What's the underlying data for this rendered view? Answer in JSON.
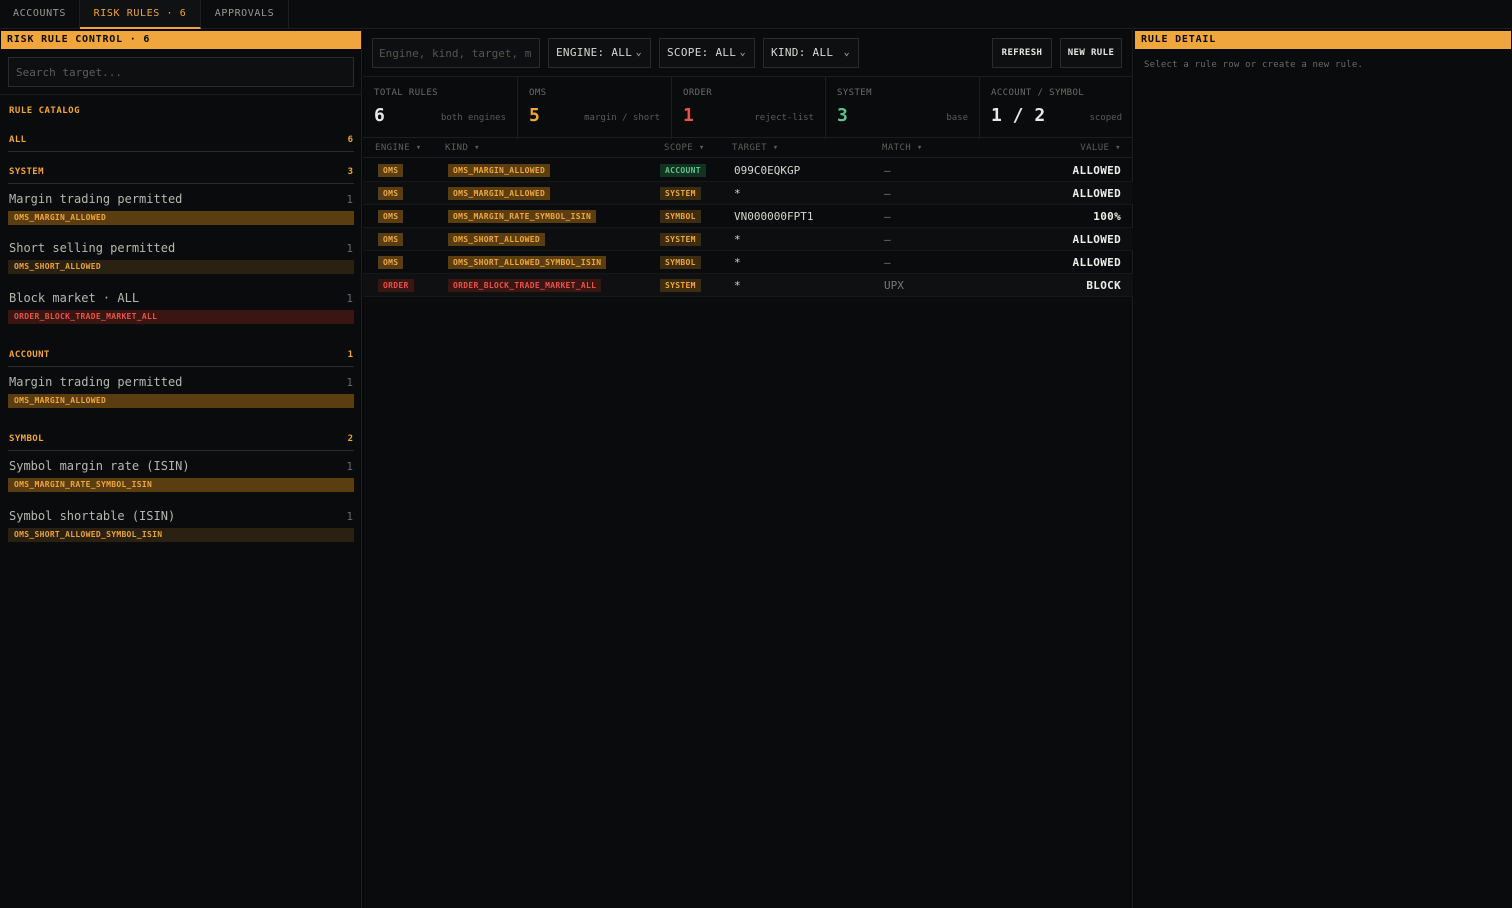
{
  "top_tabs": [
    {
      "label": "ACCOUNTS"
    },
    {
      "label": "RISK RULES · 6"
    },
    {
      "label": "APPROVALS"
    }
  ],
  "left": {
    "header": "RISK RULE CONTROL · 6",
    "search_placeholder": "Search target...",
    "catalog_title": "RULE CATALOG",
    "all": {
      "label": "ALL",
      "count": "6"
    },
    "groups": [
      {
        "label": "SYSTEM",
        "count": "3",
        "items": [
          {
            "name": "Margin trading permitted",
            "count": "1",
            "code": "OMS_MARGIN_ALLOWED",
            "tone": "amber"
          },
          {
            "name": "Short selling permitted",
            "count": "1",
            "code": "OMS_SHORT_ALLOWED",
            "tone": "brown"
          },
          {
            "name": "Block market · ALL",
            "count": "1",
            "code": "ORDER_BLOCK_TRADE_MARKET_ALL",
            "tone": "red"
          }
        ]
      },
      {
        "label": "ACCOUNT",
        "count": "1",
        "items": [
          {
            "name": "Margin trading permitted",
            "count": "1",
            "code": "OMS_MARGIN_ALLOWED",
            "tone": "amber"
          }
        ]
      },
      {
        "label": "SYMBOL",
        "count": "2",
        "items": [
          {
            "name": "Symbol margin rate (ISIN)",
            "count": "1",
            "code": "OMS_MARGIN_RATE_SYMBOL_ISIN",
            "tone": "amber"
          },
          {
            "name": "Symbol shortable (ISIN)",
            "count": "1",
            "code": "OMS_SHORT_ALLOWED_SYMBOL_ISIN",
            "tone": "brown"
          }
        ]
      }
    ]
  },
  "toolbar": {
    "filter_placeholder": "Engine, kind, target, m",
    "engine": "ENGINE: ALL",
    "scope": "SCOPE: ALL",
    "kind": "KIND: ALL",
    "refresh": "REFRESH",
    "new_rule": "NEW RULE"
  },
  "stats": [
    {
      "title": "TOTAL RULES",
      "value": "6",
      "sub": "both engines",
      "color": "#e8e8e4"
    },
    {
      "title": "OMS",
      "value": "5",
      "sub": "margin / short",
      "color": "#f0a63c"
    },
    {
      "title": "ORDER",
      "value": "1",
      "sub": "reject-list",
      "color": "#e5544a"
    },
    {
      "title": "SYSTEM",
      "value": "3",
      "sub": "base",
      "color": "#5fc28a"
    },
    {
      "title": "ACCOUNT / SYMBOL",
      "value": "1 / 2",
      "sub": "scoped",
      "color": "#e8e8e4"
    }
  ],
  "table": {
    "headers": {
      "engine": "ENGINE",
      "kind": "KIND",
      "scope": "SCOPE",
      "target": "TARGET",
      "match": "MATCH",
      "value": "VALUE"
    },
    "sort_glyph": "▾",
    "rows": [
      {
        "engine": "OMS",
        "kind": "OMS_MARGIN_ALLOWED",
        "scope": "ACCOUNT",
        "target": "099C0EQKGP",
        "match": "—",
        "value": "ALLOWED"
      },
      {
        "engine": "OMS",
        "kind": "OMS_MARGIN_ALLOWED",
        "scope": "SYSTEM",
        "target": "*",
        "match": "—",
        "value": "ALLOWED"
      },
      {
        "engine": "OMS",
        "kind": "OMS_MARGIN_RATE_SYMBOL_ISIN",
        "scope": "SYMBOL",
        "target": "VN000000FPT1",
        "match": "—",
        "value": "100%"
      },
      {
        "engine": "OMS",
        "kind": "OMS_SHORT_ALLOWED",
        "scope": "SYSTEM",
        "target": "*",
        "match": "—",
        "value": "ALLOWED"
      },
      {
        "engine": "OMS",
        "kind": "OMS_SHORT_ALLOWED_SYMBOL_ISIN",
        "scope": "SYMBOL",
        "target": "*",
        "match": "—",
        "value": "ALLOWED"
      },
      {
        "engine": "ORDER",
        "kind": "ORDER_BLOCK_TRADE_MARKET_ALL",
        "scope": "SYSTEM",
        "target": "*",
        "match": "UPX",
        "value": "BLOCK"
      }
    ]
  },
  "right": {
    "header": "RULE DETAIL",
    "hint": "Select a rule row or create a new rule."
  },
  "colors": {
    "accent": "#f0a63c",
    "danger": "#e5544a",
    "success": "#5fc28a"
  }
}
